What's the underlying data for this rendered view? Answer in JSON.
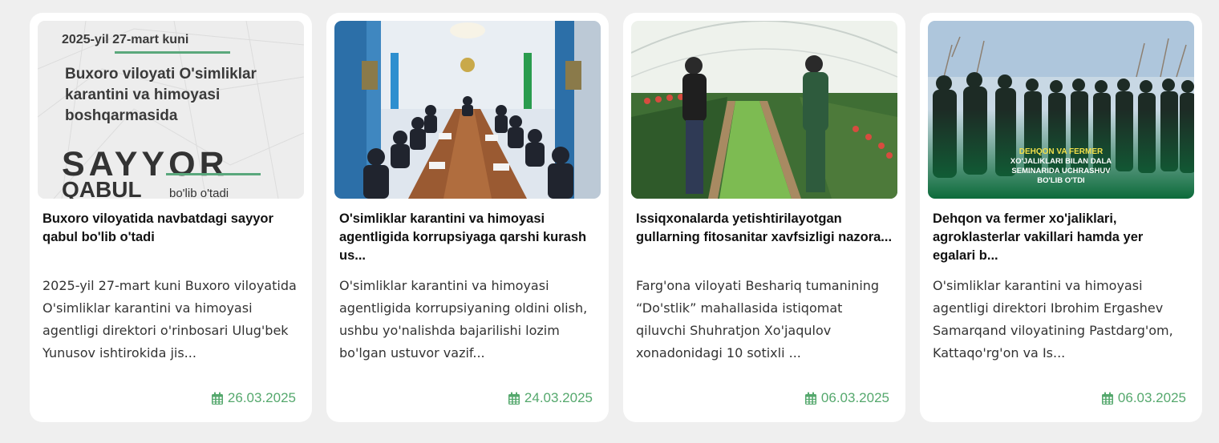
{
  "colors": {
    "background": "#efefef",
    "card": "#ffffff",
    "date_accent": "#55a86d",
    "title": "#111111",
    "excerpt": "#333333"
  },
  "icons": {
    "date": "calendar-icon"
  },
  "cards": [
    {
      "title": "Buxoro viloyatida navbatdagi sayyor qabul bo'lib o'tadi",
      "excerpt": "2025-yil 27-mart kuni Buxoro viloyatida O'simliklar karantini va himoyasi agentligi direktori o'rinbosari Ulug'bek Yunusov ishtirokida jis...",
      "date": "26.03.2025",
      "image": {
        "date_line": "2025-yil 27-mart kuni",
        "desc_lines": [
          "Buxoro viloyati O'simliklar",
          "karantini va himoyasi",
          "boshqarmasida"
        ],
        "big1": "SAYYOR",
        "big2": "QABUL",
        "small": "bo'lib o'tadi"
      }
    },
    {
      "title": "O'simliklar karantini va himoyasi agentligida korrupsiyaga qarshi kurash us...",
      "excerpt": "O'simliklar karantini va himoyasi agentligida korrupsiyaning oldini olish, ushbu yo'nalishda bajarilishi lozim bo'lgan ustuvor vazif...",
      "date": "24.03.2025"
    },
    {
      "title": "Issiqxonalarda yetishtirilayotgan gullarning fitosanitar xavfsizligi nazora...",
      "excerpt": "Farg'ona viloyati Beshariq tumanining “Do'stlik” mahallasida istiqomat qiluvchi Shuhratjon Xo'jaqulov xonadonidagi 10 sotixli ...",
      "date": "06.03.2025"
    },
    {
      "title": "Dehqon va fermer xo'jaliklari, agroklasterlar vakillari hamda yer egalari b...",
      "excerpt": "O'simliklar karantini va himoyasi agentligi direktori Ibrohim Ergashev Samarqand viloyatining Pastdarg'om, Kattaqo'rg'on va Is...",
      "date": "06.03.2025",
      "image": {
        "banner_lines": [
          "DEHQON VA FERMER",
          "XO'JALIKLARI BILAN DALA",
          "SEMINARIDA UCHRASHUV",
          "BO'LIB O'TDI"
        ]
      }
    }
  ]
}
